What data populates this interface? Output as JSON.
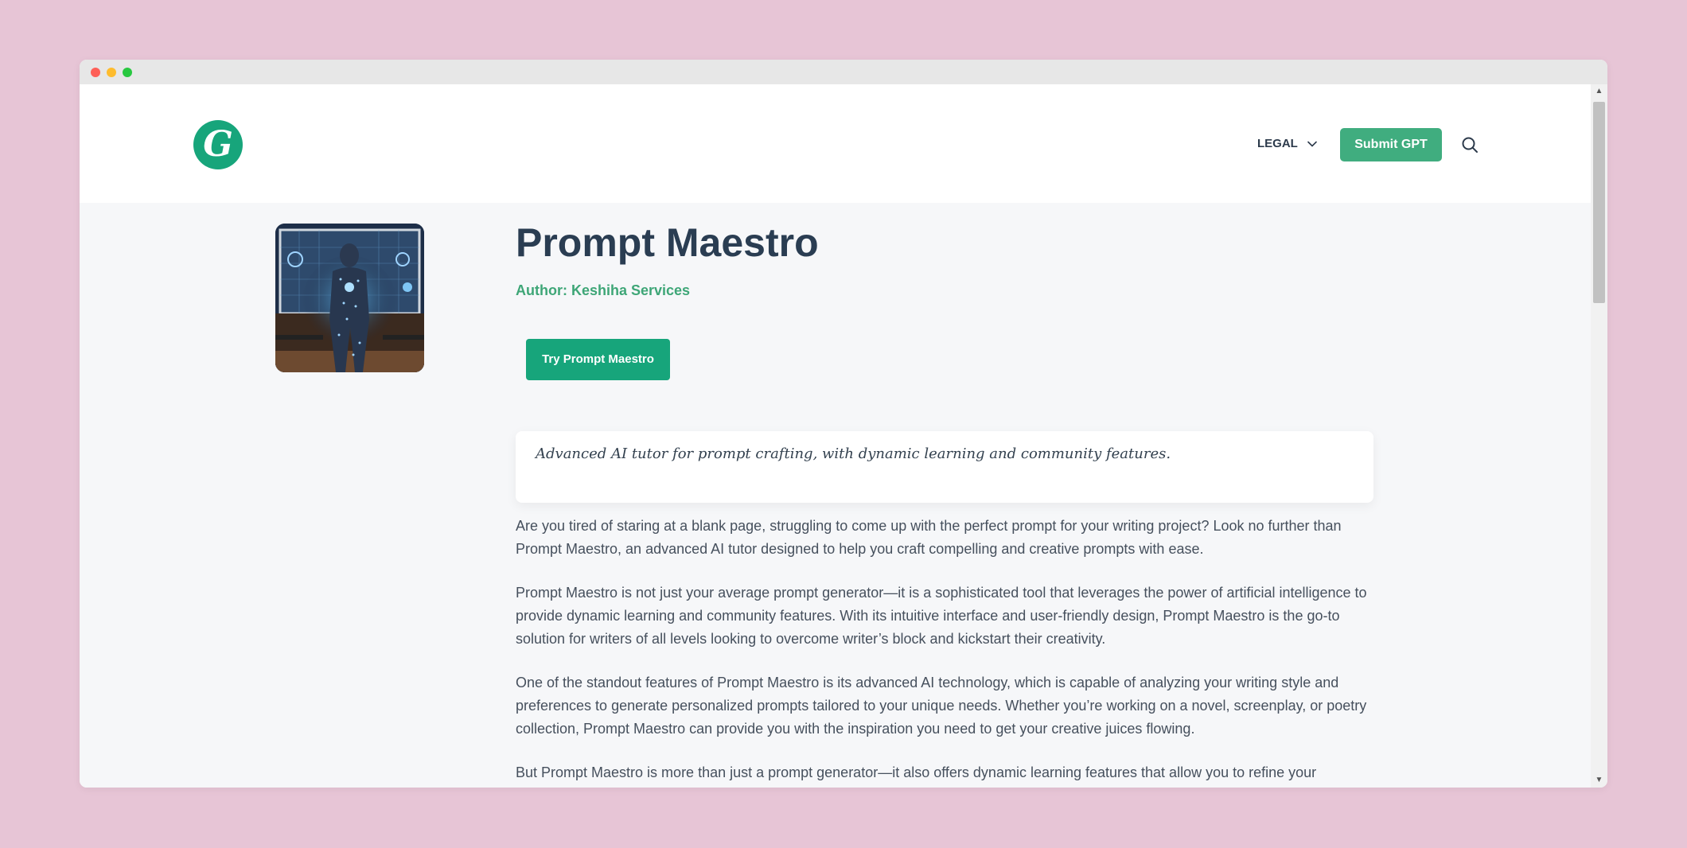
{
  "header": {
    "logo_letter": "G",
    "nav_legal_label": "LEGAL",
    "submit_label": "Submit GPT"
  },
  "gpt": {
    "title": "Prompt Maestro",
    "author": "Author: Keshiha Services",
    "try_label": "Try Prompt Maestro",
    "tagline": "Advanced AI tutor for prompt crafting, with dynamic learning and community features.",
    "paragraphs": [
      "Are you tired of staring at a blank page, struggling to come up with the perfect prompt for your writing project? Look no further than Prompt Maestro, an advanced AI tutor designed to help you craft compelling and creative prompts with ease.",
      "Prompt Maestro is not just your average prompt generator—it is a sophisticated tool that leverages the power of artificial intelligence to provide dynamic learning and community features. With its intuitive interface and user-friendly design, Prompt Maestro is the go-to solution for writers of all levels looking to overcome writer’s block and kickstart their creativity.",
      "One of the standout features of Prompt Maestro is its advanced AI technology, which is capable of analyzing your writing style and preferences to generate personalized prompts tailored to your unique needs. Whether you’re working on a novel, screenplay, or poetry collection, Prompt Maestro can provide you with the inspiration you need to get your creative juices flowing.",
      "But Prompt Maestro is more than just a prompt generator—it also offers dynamic learning features that allow you to refine your"
    ]
  },
  "icons": {
    "search": "search-icon",
    "chevron": "chevron-down-icon"
  },
  "colors": {
    "accent": "#17a57b",
    "submit": "#40ad7f",
    "author": "#3ea677",
    "title": "#2a3d52",
    "background": "#e7c5d6"
  }
}
